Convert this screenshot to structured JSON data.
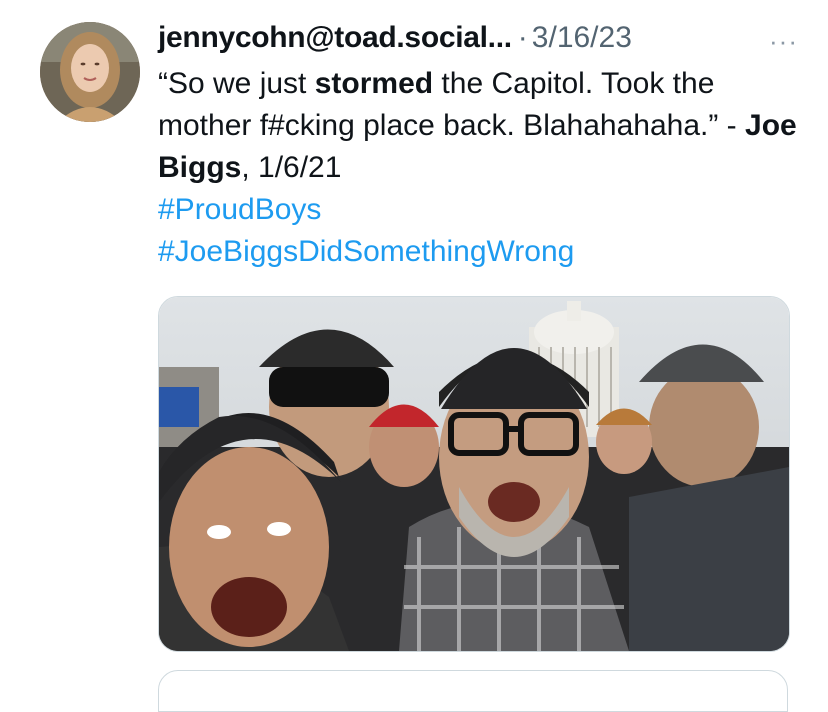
{
  "tweet": {
    "handle": "jennycohn@toad.social...",
    "separator": "·",
    "date": "3/16/23",
    "more_icon": "···",
    "text": {
      "open_quote": "“So we just ",
      "emph1": "stormed",
      "part2": " the Capitol. Took the mother f#cking place back. Blahahahaha.” - ",
      "emph2": "Joe Biggs",
      "part3": ", 1/6/21"
    },
    "hashtags": [
      "#ProudBoys",
      "#JoeBiggsDidSomethingWrong"
    ]
  },
  "colors": {
    "link": "#1d9bf0",
    "secondary_text": "#536471",
    "border": "#cfd9de"
  },
  "media": {
    "kind": "photo"
  }
}
